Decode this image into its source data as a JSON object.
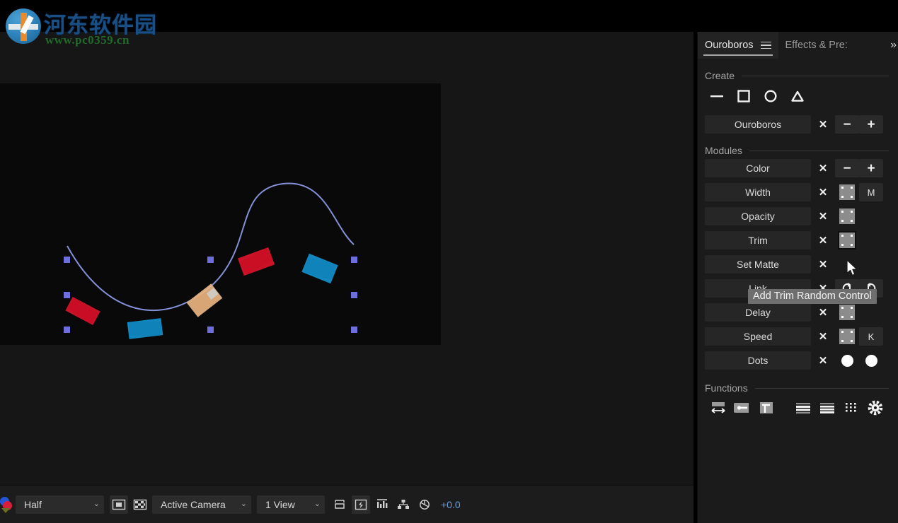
{
  "watermark": {
    "site_cn": "河东软件园",
    "url": "www.pc0359.cn",
    "logo_icon": "pc0359-logo-icon"
  },
  "viewer": {
    "bar": {
      "color_swatch_icon": "channel-color-swatch-icon",
      "quality": {
        "value": "Half",
        "chevron": "⌄"
      },
      "camera": {
        "value": "Active Camera",
        "chevron": "⌄"
      },
      "views": {
        "value": "1 View",
        "chevron": "⌄"
      },
      "icons": [
        {
          "name": "region-of-interest-icon",
          "boxed": true
        },
        {
          "name": "transparency-grid-icon",
          "boxed": false
        },
        {
          "name": "toggle-mask-paths-icon",
          "boxed": false
        },
        {
          "name": "fast-previews-icon",
          "boxed": true
        },
        {
          "name": "timeline-graph-icon",
          "boxed": false
        },
        {
          "name": "render-flowchart-icon",
          "boxed": false
        },
        {
          "name": "refresh-shutter-icon",
          "boxed": false
        }
      ],
      "exposure": "+0.0"
    },
    "composition": {
      "background": "#090909",
      "path_color": "#8e9ce8",
      "dash_colors": [
        "#e2152f",
        "#1496d2",
        "#e8b583"
      ],
      "handle_color": "#6e6edc"
    }
  },
  "dock": {
    "tabs": [
      {
        "label": "Ouroboros",
        "active": true,
        "menu_icon": "panel-menu-icon"
      },
      {
        "label": "Effects & Pre:",
        "active": false
      }
    ],
    "expand_icon": "»",
    "sections": {
      "create": {
        "title": "Create",
        "shapes": [
          {
            "name": "line-shape-icon",
            "label": "line"
          },
          {
            "name": "square-shape-icon",
            "label": "square"
          },
          {
            "name": "circle-shape-icon",
            "label": "circle"
          },
          {
            "name": "triangle-shape-icon",
            "label": "triangle"
          }
        ],
        "item": {
          "label": "Ouroboros",
          "delete_icon": "✕",
          "minus_label": "−",
          "plus_label": "+"
        }
      },
      "modules": {
        "title": "Modules",
        "rows": [
          {
            "label": "Color",
            "delete": "✕",
            "ctrl2": {
              "kind": "sign",
              "value": "−",
              "boxed": true
            },
            "ctrl3": {
              "kind": "sign",
              "value": "+",
              "boxed": true
            }
          },
          {
            "label": "Width",
            "delete": "✕",
            "ctrl2": {
              "kind": "dotbox",
              "value": "",
              "boxed": false
            },
            "ctrl3": {
              "kind": "letter",
              "value": "M",
              "boxed": true
            }
          },
          {
            "label": "Opacity",
            "delete": "✕",
            "ctrl2": {
              "kind": "dotbox",
              "value": "",
              "boxed": false
            },
            "ctrl3": {
              "kind": "none",
              "value": "",
              "boxed": false
            }
          },
          {
            "label": "Trim",
            "delete": "✕",
            "ctrl2": {
              "kind": "dotbox-selected",
              "value": "",
              "boxed": false
            },
            "ctrl3": {
              "kind": "none",
              "value": "",
              "boxed": false
            }
          },
          {
            "label": "Set Matte",
            "delete": "✕",
            "ctrl2": {
              "kind": "none",
              "value": "",
              "boxed": false
            },
            "ctrl3": {
              "kind": "none",
              "value": "",
              "boxed": false
            }
          },
          {
            "label": "Link",
            "delete": "✕",
            "ctrl2": {
              "kind": "link-left",
              "value": "",
              "boxed": true
            },
            "ctrl3": {
              "kind": "link-right",
              "value": "",
              "boxed": true
            }
          },
          {
            "label": "Delay",
            "delete": "✕",
            "ctrl2": {
              "kind": "dotbox",
              "value": "",
              "boxed": false
            },
            "ctrl3": {
              "kind": "none",
              "value": "",
              "boxed": false
            }
          },
          {
            "label": "Speed",
            "delete": "✕",
            "ctrl2": {
              "kind": "dotbox",
              "value": "",
              "boxed": false
            },
            "ctrl3": {
              "kind": "letter",
              "value": "K",
              "boxed": true
            }
          },
          {
            "label": "Dots",
            "delete": "✕",
            "ctrl2": {
              "kind": "circle",
              "value": "",
              "boxed": false
            },
            "ctrl3": {
              "kind": "circle",
              "value": "",
              "boxed": false
            }
          }
        ]
      },
      "functions": {
        "title": "Functions",
        "icons": [
          {
            "name": "stretch-horizontal-icon"
          },
          {
            "name": "align-start-icon"
          },
          {
            "name": "corner-path-icon"
          },
          {
            "name": "list-rows-icon"
          },
          {
            "name": "list-rows-alt-icon"
          },
          {
            "name": "dot-grid-icon"
          },
          {
            "name": "settings-gear-icon"
          }
        ]
      }
    }
  },
  "tooltip": {
    "text": "Add Trim Random Control"
  },
  "cursor": {
    "name": "mouse-pointer-icon"
  }
}
